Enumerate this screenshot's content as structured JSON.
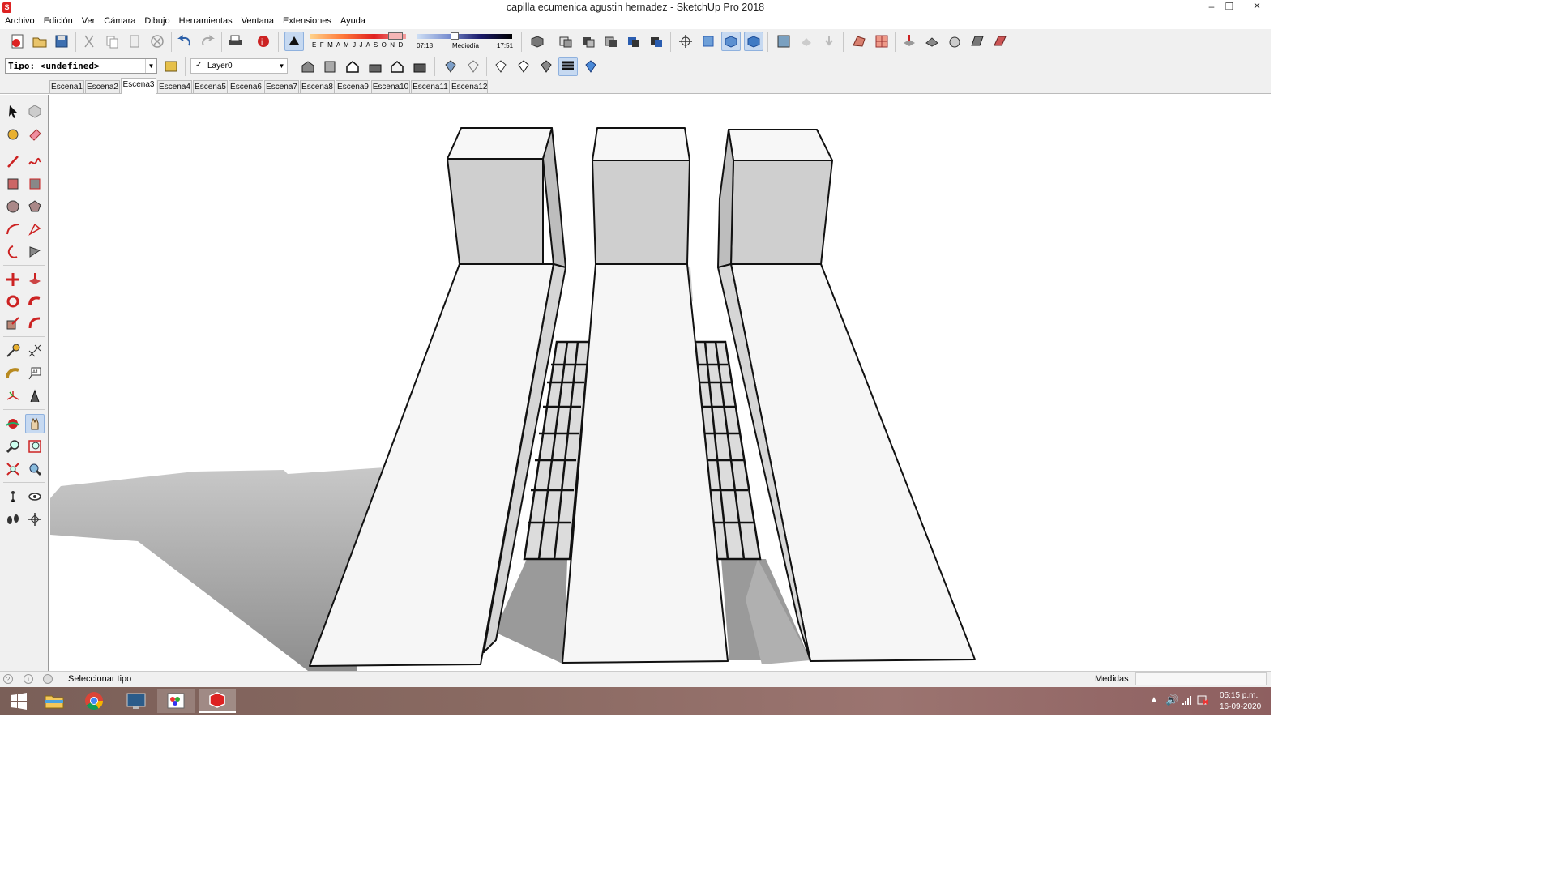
{
  "window": {
    "title": "capilla ecumenica agustin hernadez - SketchUp Pro 2018",
    "minimize": "–",
    "restore": "❐",
    "close": "×"
  },
  "menu": [
    "Archivo",
    "Edición",
    "Ver",
    "Cámara",
    "Dibujo",
    "Herramientas",
    "Ventana",
    "Extensiones",
    "Ayuda"
  ],
  "shadow_toolbar": {
    "months": "E F M A M J J A S O N D",
    "time_start": "07:18",
    "time_mid": "Mediodía",
    "time_end": "17:51"
  },
  "type_selector": {
    "value": "Tipo: <undefined>"
  },
  "layer_selector": {
    "check": "✓",
    "value": "Layer0"
  },
  "scenes": [
    "Escena1",
    "Escena2",
    "Escena3",
    "Escena4",
    "Escena5",
    "Escena6",
    "Escena7",
    "Escena8",
    "Escena9",
    "Escena10",
    "Escena11",
    "Escena12"
  ],
  "active_scene": "Escena3",
  "status": {
    "message": "Seleccionar tipo",
    "measurements_label": "Medidas",
    "measurements_value": ""
  },
  "taskbar": {
    "time": "05:15 p.m.",
    "date": "16-09-2020"
  },
  "colors": {
    "selection": "#c6d9f1",
    "shadow": "#b8b8b8",
    "face": "#f6f6f6",
    "face_side": "#cfcfcf",
    "edge": "#111111",
    "taskbar": "#8a6a62",
    "sketchup_red": "#d22222"
  },
  "icons": {
    "toolbar1": [
      "new-file-icon",
      "open-file-icon",
      "save-icon",
      "cut-icon",
      "copy-icon",
      "paste-icon",
      "erase-icon",
      "undo-icon",
      "redo-icon",
      "print-icon",
      "model-info-icon",
      "shadows-toggle-icon",
      "shadow-month-slider-icon",
      "shadow-time-slider-icon",
      "xray-icon",
      "component-icon",
      "section-plane-icon",
      "face-style-icon",
      "hidden-line-icon",
      "shaded-icon",
      "orbit-icon",
      "pan-icon",
      "zoom-icon",
      "zoom-extents-icon",
      "warehouse-icon",
      "share-model-icon",
      "extension-icon",
      "sandbox-icon",
      "terrain-icon",
      "push-pull-sandbox-icon",
      "drape-icon",
      "smoove-icon",
      "stamp-icon",
      "flip-edge-icon"
    ],
    "toolbar2": [
      "type-selector-icon",
      "layer-icon",
      "iso-view-icon",
      "top-view-icon",
      "front-view-icon",
      "right-view-icon",
      "back-view-icon",
      "left-view-icon",
      "xray-style-icon",
      "wireframe-icon",
      "hidden-line-style-icon",
      "shaded-style-icon",
      "shaded-textures-icon",
      "monochrome-icon"
    ],
    "left": [
      "select-icon",
      "component-icon",
      "paint-bucket-icon",
      "eraser-icon",
      "line-icon",
      "freehand-icon",
      "rectangle-icon",
      "rotated-rectangle-icon",
      "circle-icon",
      "polygon-icon",
      "arc-icon",
      "two-point-arc-icon",
      "three-point-arc-icon",
      "pie-icon",
      "move-icon",
      "push-pull-icon",
      "rotate-icon",
      "follow-me-icon",
      "scale-icon",
      "offset-icon",
      "tape-measure-icon",
      "dimension-icon",
      "protractor-icon",
      "text-icon",
      "axes-icon",
      "3d-text-icon",
      "orbit-icon",
      "pan-icon",
      "zoom-icon",
      "zoom-window-icon",
      "zoom-extents-icon",
      "previous-view-icon",
      "position-camera-icon",
      "look-around-icon",
      "walk-icon",
      "section-plane-icon"
    ]
  }
}
